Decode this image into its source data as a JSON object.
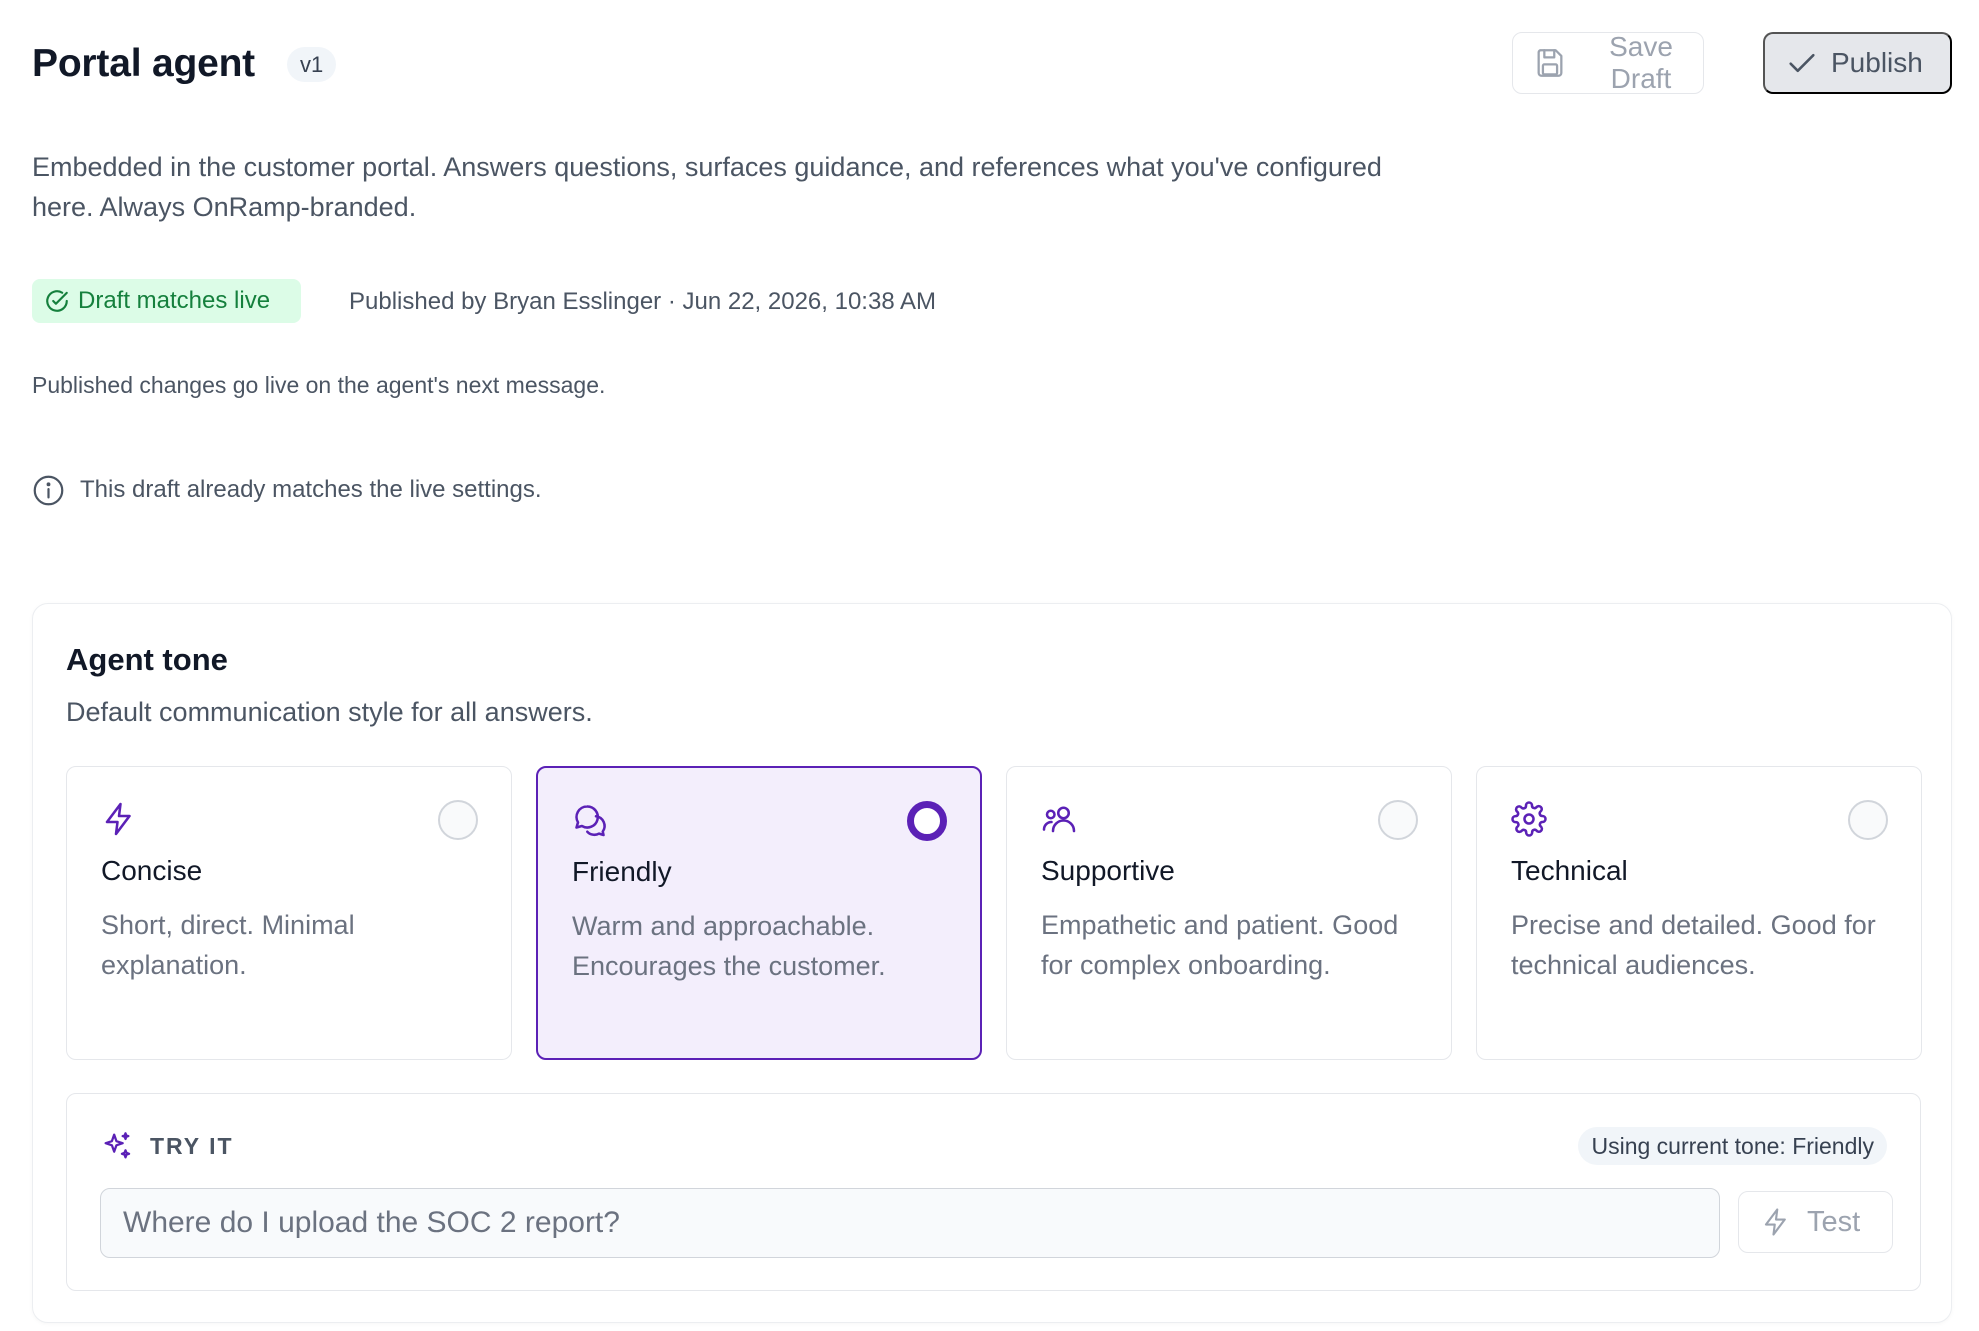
{
  "header": {
    "title": "Portal agent",
    "version": "v1",
    "save_label": "Save Draft",
    "publish_label": "Publish",
    "save_icon": "save-icon",
    "publish_icon": "check-icon"
  },
  "description": "Embedded in the customer portal. Answers questions, surfaces guidance, and references what you've configured here. Always OnRamp-branded.",
  "status": {
    "badge": "Draft matches live",
    "published_by": "Published by Bryan Esslinger · Jun 22, 2026, 10:38 AM",
    "badge_color": "#15803d"
  },
  "note": "Published changes go live on the agent's next message.",
  "info": "This draft already matches the live settings.",
  "tone_section": {
    "title": "Agent tone",
    "subtitle": "Default communication style for all answers.",
    "accent": "#5b21b6",
    "options": [
      {
        "name": "Concise",
        "description": "Short, direct. Minimal explanation.",
        "icon": "bolt-icon",
        "selected": false
      },
      {
        "name": "Friendly",
        "description": "Warm and approachable. Encourages the customer.",
        "icon": "chat-bubbles-icon",
        "selected": true
      },
      {
        "name": "Supportive",
        "description": "Empathetic and patient. Good for complex onboarding.",
        "icon": "users-icon",
        "selected": false
      },
      {
        "name": "Technical",
        "description": "Precise and detailed. Good for technical audiences.",
        "icon": "gear-icon",
        "selected": false
      }
    ]
  },
  "try_it": {
    "label": "TRY IT",
    "current_tone": "Using current tone: Friendly",
    "placeholder": "Where do I upload the SOC 2 report?",
    "test_label": "Test",
    "icon": "sparkles-icon"
  }
}
